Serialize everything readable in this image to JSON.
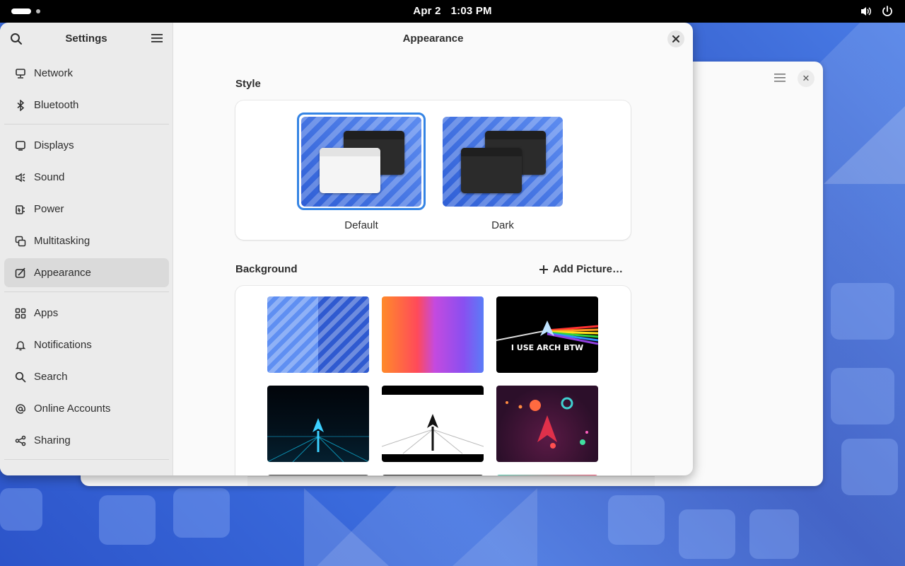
{
  "topbar": {
    "date": "Apr 2",
    "time": "1:03 PM",
    "icons": [
      "activities-indicator",
      "volume-icon",
      "power-icon"
    ]
  },
  "sidebar": {
    "title": "Settings",
    "items": [
      {
        "label": "Network",
        "icon": "network-icon"
      },
      {
        "label": "Bluetooth",
        "icon": "bluetooth-icon"
      },
      {
        "label": "Displays",
        "icon": "display-icon"
      },
      {
        "label": "Sound",
        "icon": "speaker-icon"
      },
      {
        "label": "Power",
        "icon": "power-plug-icon"
      },
      {
        "label": "Multitasking",
        "icon": "multitasking-icon"
      },
      {
        "label": "Appearance",
        "icon": "appearance-icon",
        "active": true
      },
      {
        "label": "Apps",
        "icon": "apps-grid-icon"
      },
      {
        "label": "Notifications",
        "icon": "bell-icon"
      },
      {
        "label": "Search",
        "icon": "search-icon"
      },
      {
        "label": "Online Accounts",
        "icon": "at-icon"
      },
      {
        "label": "Sharing",
        "icon": "share-icon"
      }
    ]
  },
  "main": {
    "title": "Appearance",
    "style_section": {
      "label": "Style",
      "options": [
        {
          "label": "Default",
          "selected": true
        },
        {
          "label": "Dark",
          "selected": false
        }
      ]
    },
    "background_section": {
      "label": "Background",
      "add_button": "Add Picture…",
      "arch_caption": "I USE ARCH BTW"
    }
  },
  "colors": {
    "accent": "#3584e4",
    "sidebar_bg": "#ebebeb",
    "window_bg": "#fafafa",
    "wallpaper": "#2f5fd6"
  }
}
